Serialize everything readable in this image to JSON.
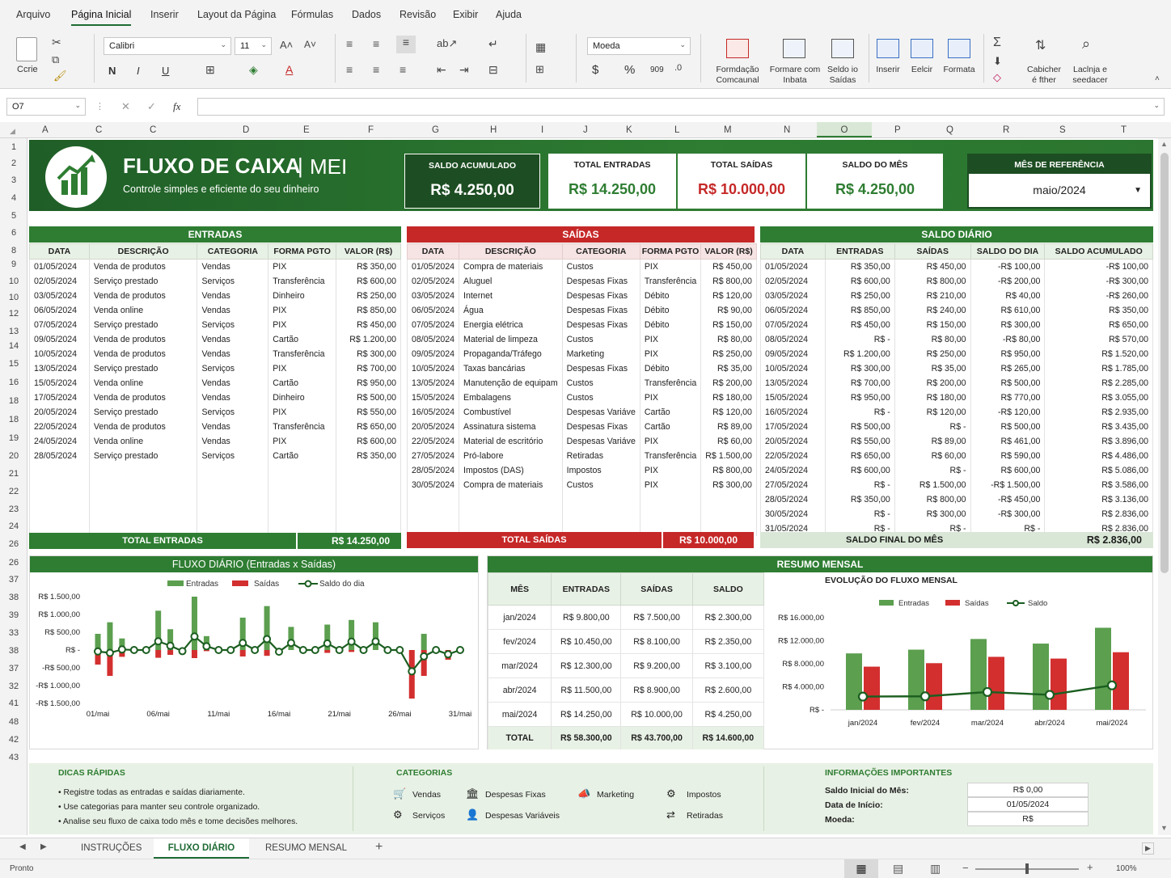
{
  "menu": [
    "Arquivo",
    "Página Inicial",
    "Inserir",
    "Layout da Página",
    "Fórmulas",
    "Dados",
    "Revisão",
    "Exibir",
    "Ajuda"
  ],
  "ribbon": {
    "paste": "Ccrie",
    "font": "Calibri",
    "size": "11",
    "bold": "N",
    "italic": "I",
    "underline": "U",
    "numfmt": "Moeda",
    "currency": "$",
    "percent": "%",
    "thousands": "909",
    "cond_fmt": [
      "Formdação",
      "Comcaunal"
    ],
    "fmt_table": [
      "Formare com",
      "Inbata"
    ],
    "cell_styles": [
      "Seldo io",
      "Saídas"
    ],
    "insert": "Inserir",
    "delete": "Eelcir",
    "format": "Formata",
    "sort": [
      "Cabicher",
      "é fther"
    ],
    "find": [
      "Laclnja e",
      "seedacer"
    ]
  },
  "formula": {
    "namebox": "O7",
    "fx": "fx"
  },
  "columns": [
    "A",
    "C",
    "C",
    "D",
    "E",
    "F",
    "G",
    "H",
    "I",
    "J",
    "K",
    "L",
    "M",
    "N",
    "O",
    "P",
    "Q",
    "R",
    "S",
    "T"
  ],
  "rows": [
    "1",
    "2",
    "3",
    "4",
    "5",
    "6",
    "8",
    "9",
    "10",
    "10",
    "12",
    "13",
    "14",
    "15",
    "16",
    "18",
    "18",
    "19",
    "20",
    "21",
    "22",
    "23",
    "24",
    "26",
    "26",
    "37",
    "38",
    "39",
    "33",
    "38",
    "37",
    "32",
    "41",
    "48",
    "42",
    "43"
  ],
  "banner": {
    "title": "FLUXO DE CAIXA",
    "subtitle_tag": "MEI",
    "tagline": "Controle simples e eficiente do seu dinheiro"
  },
  "kpis": {
    "saldo_acum": {
      "label": "SALDO ACUMULADO",
      "value": "R$ 4.250,00"
    },
    "entradas": {
      "label": "TOTAL ENTRADAS",
      "value": "R$ 14.250,00"
    },
    "saidas": {
      "label": "TOTAL SAÍDAS",
      "value": "R$ 10.000,00"
    },
    "saldo_mes": {
      "label": "SALDO DO MÊS",
      "value": "R$ 4.250,00"
    },
    "mes_ref": {
      "label": "MÊS DE REFERÊNCIA",
      "value": "maio/2024"
    }
  },
  "entradas": {
    "title": "ENTRADAS",
    "headers": [
      "DATA",
      "DESCRIÇÃO",
      "CATEGORIA",
      "FORMA PGTO",
      "VALOR (R$)"
    ],
    "rows": [
      [
        "01/05/2024",
        "Venda de produtos",
        "Vendas",
        "PIX",
        "R$ 350,00"
      ],
      [
        "02/05/2024",
        "Serviço prestado",
        "Serviços",
        "Transferência",
        "R$ 600,00"
      ],
      [
        "03/05/2024",
        "Venda de produtos",
        "Vendas",
        "Dinheiro",
        "R$ 250,00"
      ],
      [
        "06/05/2024",
        "Venda online",
        "Vendas",
        "PIX",
        "R$ 850,00"
      ],
      [
        "07/05/2024",
        "Serviço prestado",
        "Serviços",
        "PIX",
        "R$ 450,00"
      ],
      [
        "09/05/2024",
        "Venda de produtos",
        "Vendas",
        "Cartão",
        "R$ 1.200,00"
      ],
      [
        "10/05/2024",
        "Venda de produtos",
        "Vendas",
        "Transferência",
        "R$ 300,00"
      ],
      [
        "13/05/2024",
        "Serviço prestado",
        "Serviços",
        "PIX",
        "R$ 700,00"
      ],
      [
        "15/05/2024",
        "Venda online",
        "Vendas",
        "Cartão",
        "R$ 950,00"
      ],
      [
        "17/05/2024",
        "Venda de produtos",
        "Vendas",
        "Dinheiro",
        "R$ 500,00"
      ],
      [
        "20/05/2024",
        "Serviço prestado",
        "Serviços",
        "PIX",
        "R$ 550,00"
      ],
      [
        "22/05/2024",
        "Venda de produtos",
        "Vendas",
        "Transferência",
        "R$ 650,00"
      ],
      [
        "24/05/2024",
        "Venda online",
        "Vendas",
        "PIX",
        "R$ 600,00"
      ],
      [
        "28/05/2024",
        "Serviço prestado",
        "Serviços",
        "Cartão",
        "R$ 350,00"
      ],
      [
        "",
        "",
        "",
        "",
        ""
      ],
      [
        "",
        "",
        "",
        "",
        ""
      ],
      [
        "",
        "",
        "",
        "",
        ""
      ],
      [
        "",
        "",
        "",
        "",
        ""
      ],
      [
        "",
        "",
        "",
        "",
        ""
      ]
    ],
    "total_label": "TOTAL ENTRADAS",
    "total": "R$ 14.250,00"
  },
  "saidas": {
    "title": "SAÍDAS",
    "headers": [
      "DATA",
      "DESCRIÇÃO",
      "CATEGORIA",
      "FORMA PGTO",
      "VALOR (R$)"
    ],
    "rows": [
      [
        "01/05/2024",
        "Compra de materiais",
        "Custos",
        "PIX",
        "R$ 450,00"
      ],
      [
        "02/05/2024",
        "Aluguel",
        "Despesas Fixas",
        "Transferência",
        "R$ 800,00"
      ],
      [
        "03/05/2024",
        "Internet",
        "Despesas Fixas",
        "Débito",
        "R$ 120,00"
      ],
      [
        "06/05/2024",
        "Água",
        "Despesas Fixas",
        "Débito",
        "R$ 90,00"
      ],
      [
        "07/05/2024",
        "Energia elétrica",
        "Despesas Fixas",
        "Débito",
        "R$ 150,00"
      ],
      [
        "08/05/2024",
        "Material de limpeza",
        "Custos",
        "PIX",
        "R$ 80,00"
      ],
      [
        "09/05/2024",
        "Propaganda/Tráfego",
        "Marketing",
        "PIX",
        "R$ 250,00"
      ],
      [
        "10/05/2024",
        "Taxas bancárias",
        "Despesas Fixas",
        "Débito",
        "R$ 35,00"
      ],
      [
        "13/05/2024",
        "Manutenção de equipam",
        "Custos",
        "Transferência",
        "R$ 200,00"
      ],
      [
        "15/05/2024",
        "Embalagens",
        "Custos",
        "PIX",
        "R$ 180,00"
      ],
      [
        "16/05/2024",
        "Combustível",
        "Despesas Variáve",
        "Cartão",
        "R$ 120,00"
      ],
      [
        "20/05/2024",
        "Assinatura sistema",
        "Despesas Fixas",
        "Cartão",
        "R$ 89,00"
      ],
      [
        "22/05/2024",
        "Material de escritório",
        "Despesas Variáve",
        "PIX",
        "R$ 60,00"
      ],
      [
        "27/05/2024",
        "Pró-labore",
        "Retiradas",
        "Transferência",
        "R$ 1.500,00"
      ],
      [
        "28/05/2024",
        "Impostos (DAS)",
        "Impostos",
        "PIX",
        "R$ 800,00"
      ],
      [
        "30/05/2024",
        "Compra de materiais",
        "Custos",
        "PIX",
        "R$ 300,00"
      ],
      [
        "",
        "",
        "",
        "",
        ""
      ],
      [
        "",
        "",
        "",
        "",
        ""
      ],
      [
        "",
        "",
        "",
        "",
        ""
      ]
    ],
    "total_label": "TOTAL SAÍDAS",
    "total": "R$ 10.000,00"
  },
  "saldo_diario": {
    "title": "SALDO DIÁRIO",
    "headers": [
      "DATA",
      "ENTRADAS",
      "SAÍDAS",
      "SALDO DO DIA",
      "SALDO ACUMULADO"
    ],
    "rows": [
      [
        "01/05/2024",
        "R$ 350,00",
        "R$ 450,00",
        "-R$ 100,00",
        "-R$ 100,00"
      ],
      [
        "02/05/2024",
        "R$ 600,00",
        "R$ 800,00",
        "-R$ 200,00",
        "-R$ 300,00"
      ],
      [
        "03/05/2024",
        "R$ 250,00",
        "R$ 210,00",
        "R$ 40,00",
        "-R$ 260,00"
      ],
      [
        "06/05/2024",
        "R$ 850,00",
        "R$ 240,00",
        "R$ 610,00",
        "R$ 350,00"
      ],
      [
        "07/05/2024",
        "R$ 450,00",
        "R$ 150,00",
        "R$ 300,00",
        "R$ 650,00"
      ],
      [
        "08/05/2024",
        "R$ -",
        "R$ 80,00",
        "-R$ 80,00",
        "R$ 570,00"
      ],
      [
        "09/05/2024",
        "R$ 1.200,00",
        "R$ 250,00",
        "R$ 950,00",
        "R$ 1.520,00"
      ],
      [
        "10/05/2024",
        "R$ 300,00",
        "R$ 35,00",
        "R$ 265,00",
        "R$ 1.785,00"
      ],
      [
        "13/05/2024",
        "R$ 700,00",
        "R$ 200,00",
        "R$ 500,00",
        "R$ 2.285,00"
      ],
      [
        "15/05/2024",
        "R$ 950,00",
        "R$ 180,00",
        "R$ 770,00",
        "R$ 3.055,00"
      ],
      [
        "16/05/2024",
        "R$ -",
        "R$ 120,00",
        "-R$ 120,00",
        "R$ 2.935,00"
      ],
      [
        "17/05/2024",
        "R$ 500,00",
        "R$ -",
        "R$ 500,00",
        "R$ 3.435,00"
      ],
      [
        "20/05/2024",
        "R$ 550,00",
        "R$ 89,00",
        "R$ 461,00",
        "R$ 3.896,00"
      ],
      [
        "22/05/2024",
        "R$ 650,00",
        "R$ 60,00",
        "R$ 590,00",
        "R$ 4.486,00"
      ],
      [
        "24/05/2024",
        "R$ 600,00",
        "R$ -",
        "R$ 600,00",
        "R$ 5.086,00"
      ],
      [
        "27/05/2024",
        "R$ -",
        "R$ 1.500,00",
        "-R$ 1.500,00",
        "R$ 3.586,00"
      ],
      [
        "28/05/2024",
        "R$ 350,00",
        "R$ 800,00",
        "-R$ 450,00",
        "R$ 3.136,00"
      ],
      [
        "30/05/2024",
        "R$ -",
        "R$ 300,00",
        "-R$ 300,00",
        "R$ 2.836,00"
      ],
      [
        "31/05/2024",
        "R$ -",
        "R$ -",
        "R$ -",
        "R$ 2.836,00"
      ]
    ],
    "total_label": "SALDO FINAL DO MÊS",
    "total": "R$ 2.836,00"
  },
  "chart_data": [
    {
      "type": "bar",
      "title": "FLUXO DIÁRIO (Entradas x Saídas)",
      "legend": [
        "Entradas",
        "Saídas",
        "Saldo do dia"
      ],
      "y_ticks": [
        "R$ 1.500,00",
        "R$ 1.000,00",
        "R$ 500,00",
        "R$ -",
        "-R$ 500,00",
        "-R$ 1.000,00",
        "-R$ 1.500,00"
      ],
      "ylim": [
        -1500,
        1500
      ],
      "x_ticks": [
        "01/mai",
        "06/mai",
        "11/mai",
        "16/mai",
        "21/mai",
        "26/mai",
        "31/mai"
      ],
      "days": 31,
      "entradas": [
        350,
        600,
        250,
        0,
        0,
        850,
        450,
        0,
        1200,
        300,
        0,
        0,
        700,
        0,
        950,
        0,
        500,
        0,
        0,
        550,
        0,
        650,
        0,
        600,
        0,
        0,
        0,
        350,
        0,
        0,
        0
      ],
      "saidas": [
        450,
        800,
        210,
        0,
        0,
        240,
        150,
        80,
        250,
        35,
        0,
        0,
        200,
        0,
        180,
        120,
        0,
        0,
        0,
        89,
        0,
        60,
        0,
        0,
        0,
        0,
        1500,
        800,
        0,
        300,
        0
      ],
      "saldo": [
        -100,
        -200,
        40,
        0,
        0,
        610,
        300,
        -80,
        950,
        265,
        0,
        0,
        500,
        0,
        770,
        -120,
        500,
        0,
        0,
        461,
        0,
        590,
        0,
        600,
        0,
        0,
        -1500,
        -450,
        0,
        -300,
        0
      ]
    },
    {
      "type": "bar",
      "title": "EVOLUÇÃO DO FLUXO MENSAL",
      "legend": [
        "Entradas",
        "Saídas",
        "Saldo"
      ],
      "categories": [
        "jan/2024",
        "fev/2024",
        "mar/2024",
        "abr/2024",
        "mai/2024"
      ],
      "y_ticks": [
        "R$ 16.000,00",
        "R$ 12.000,00",
        "R$ 8.000,00",
        "R$ 4.000,00",
        "R$ -"
      ],
      "ylim": [
        0,
        16000
      ],
      "series": [
        {
          "name": "Entradas",
          "values": [
            9800,
            10450,
            12300,
            11500,
            14250
          ]
        },
        {
          "name": "Saídas",
          "values": [
            7500,
            8100,
            9200,
            8900,
            10000
          ]
        },
        {
          "name": "Saldo",
          "values": [
            2300,
            2350,
            3100,
            2600,
            4250
          ]
        }
      ]
    }
  ],
  "resumo": {
    "title": "RESUMO MENSAL",
    "headers": [
      "MÊS",
      "ENTRADAS",
      "SAÍDAS",
      "SALDO"
    ],
    "rows": [
      [
        "jan/2024",
        "R$ 9.800,00",
        "R$ 7.500,00",
        "R$ 2.300,00"
      ],
      [
        "fev/2024",
        "R$ 10.450,00",
        "R$ 8.100,00",
        "R$ 2.350,00"
      ],
      [
        "mar/2024",
        "R$ 12.300,00",
        "R$ 9.200,00",
        "R$ 3.100,00"
      ],
      [
        "abr/2024",
        "R$ 11.500,00",
        "R$ 8.900,00",
        "R$ 2.600,00"
      ],
      [
        "mai/2024",
        "R$ 14.250,00",
        "R$ 10.000,00",
        "R$ 4.250,00"
      ]
    ],
    "total": [
      "TOTAL",
      "R$ 58.300,00",
      "R$ 43.700,00",
      "R$ 14.600,00"
    ]
  },
  "tips": {
    "title": "DICAS RÁPIDAS",
    "items": [
      "Registre todas as entradas e saídas diariamente.",
      "Use categorias para manter seu controle organizado.",
      "Analise seu fluxo de caixa todo mês e tome decisões melhores."
    ]
  },
  "categorias": {
    "title": "CATEGORIAS",
    "items": [
      "Vendas",
      "Despesas Fixas",
      "Marketing",
      "Impostos",
      "Serviços",
      "Despesas Variáveis",
      "Retiradas"
    ]
  },
  "info": {
    "title": "INFORMAÇÕES IMPORTANTES",
    "rows": [
      [
        "Saldo Inicial do Mês:",
        "R$ 0,00"
      ],
      [
        "Data de Início:",
        "01/05/2024"
      ],
      [
        "Moeda:",
        "R$"
      ]
    ]
  },
  "sheets": [
    "INSTRUÇÕES",
    "FLUXO DIÁRIO",
    "RESUMO MENSAL"
  ],
  "status": {
    "ready": "Pronto",
    "zoom": "100%"
  },
  "colors": {
    "green": "#2e7d32",
    "red": "#c62828",
    "light_green": "#e8f1e5"
  }
}
